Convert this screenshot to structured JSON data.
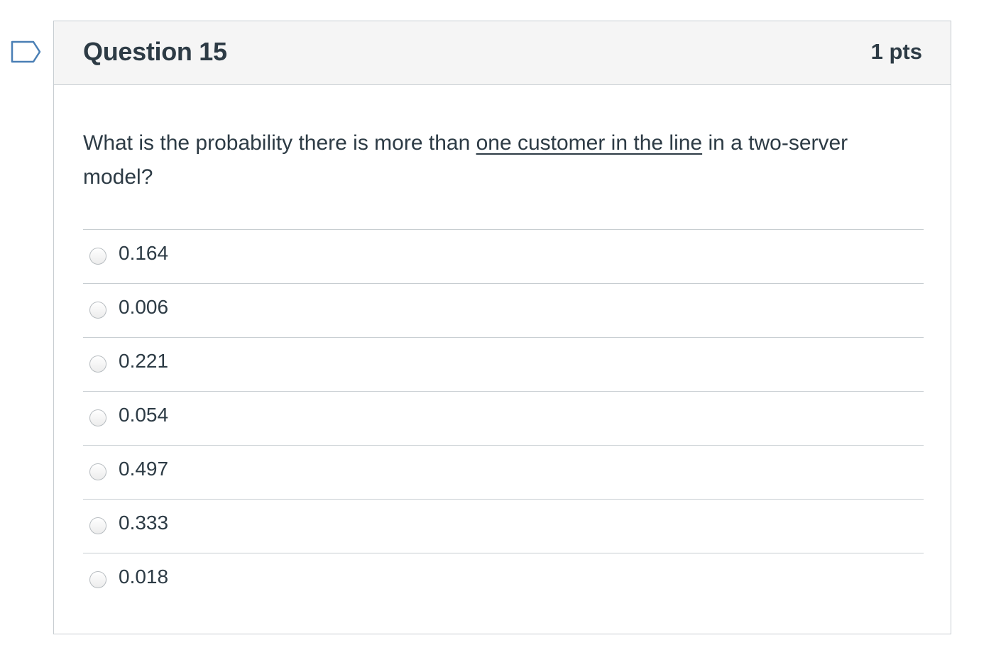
{
  "flag": {
    "icon": "bookmark-flag-icon",
    "color": "#4a7fb5"
  },
  "question": {
    "title": "Question 15",
    "points": "1 pts",
    "text_before": "What is the probability there is more than ",
    "text_underlined": "one customer in the line",
    "text_after": " in a two-server model?"
  },
  "answers": [
    {
      "label": "0.164",
      "selected": false
    },
    {
      "label": "0.006",
      "selected": false
    },
    {
      "label": "0.221",
      "selected": false
    },
    {
      "label": "0.054",
      "selected": false
    },
    {
      "label": "0.497",
      "selected": false
    },
    {
      "label": "0.333",
      "selected": false
    },
    {
      "label": "0.018",
      "selected": false
    }
  ]
}
